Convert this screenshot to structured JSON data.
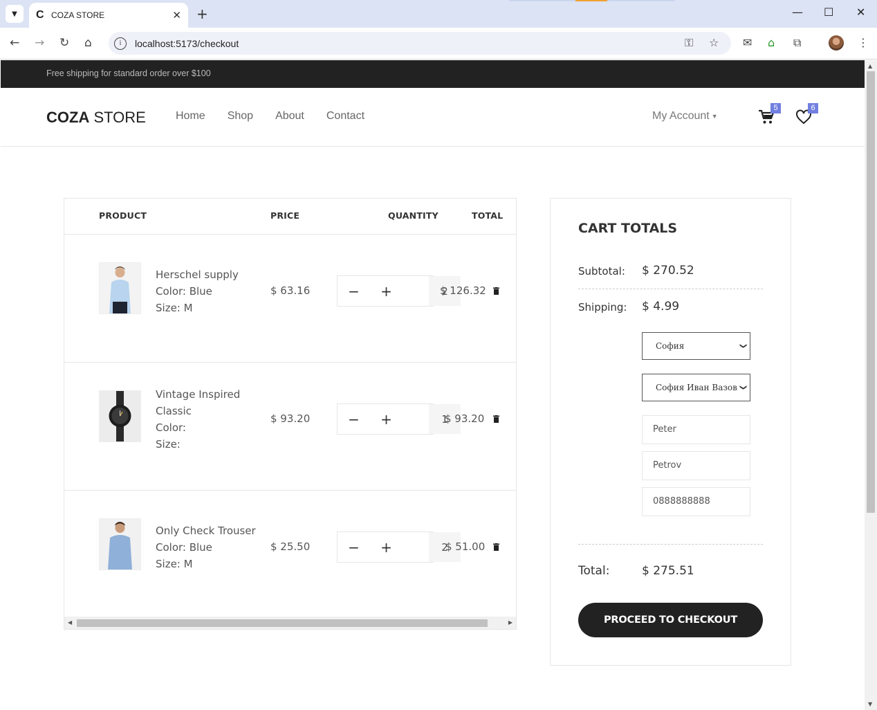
{
  "browser": {
    "tab_title": "COZA STORE",
    "tab_favicon": "C",
    "url": "localhost:5173/checkout"
  },
  "site": {
    "topbar_text": "Free shipping for standard order over $100",
    "logo_bold": "COZA",
    "logo_rest": " STORE",
    "nav": [
      "Home",
      "Shop",
      "About",
      "Contact"
    ],
    "account_label": "My Account",
    "cart_count": "5",
    "wishlist_count": "6"
  },
  "cart": {
    "headers": {
      "product": "PRODUCT",
      "price": "PRICE",
      "quantity": "QUANTITY",
      "total": "TOTAL"
    },
    "items": [
      {
        "name": "Herschel supply",
        "color": "Color: Blue",
        "size": "Size: M",
        "price": "$ 63.16",
        "qty": "2",
        "total": "$ 126.32"
      },
      {
        "name": "Vintage Inspired Classic",
        "color": "Color:",
        "size": "Size:",
        "price": "$ 93.20",
        "qty": "1",
        "total": "$ 93.20"
      },
      {
        "name": "Only Check Trouser",
        "color": "Color: Blue",
        "size": "Size: M",
        "price": "$ 25.50",
        "qty": "2",
        "total": "$ 51.00"
      }
    ],
    "minus": "−",
    "plus": "+"
  },
  "totals": {
    "title": "CART TOTALS",
    "subtotal_label": "Subtotal:",
    "subtotal_value": "$ 270.52",
    "shipping_label": "Shipping:",
    "shipping_value": "$ 4.99",
    "city_select": "София",
    "office_select": "София Иван Вазов",
    "first_name": "Peter",
    "last_name": "Petrov",
    "phone": "0888888888",
    "total_label": "Total:",
    "total_value": "$ 275.51",
    "checkout_button": "PROCEED TO CHECKOUT"
  }
}
